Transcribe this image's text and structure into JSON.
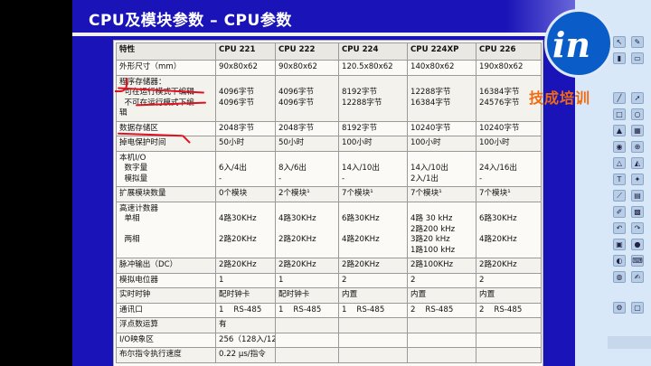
{
  "slide": {
    "title": "CPU及模块参数 – CPU参数"
  },
  "table": {
    "header": [
      "特性",
      "CPU 221",
      "CPU 222",
      "CPU 224",
      "CPU 224XP",
      "CPU 226"
    ],
    "rows": [
      {
        "label": [
          "外形尺寸（mm）"
        ],
        "cells": [
          [
            "90x80x62"
          ],
          [
            "90x80x62"
          ],
          [
            "120.5x80x62"
          ],
          [
            "140x80x62"
          ],
          [
            "190x80x62"
          ]
        ]
      },
      {
        "label": [
          "程序存储器：",
          "  可在运行模式下编辑",
          "  不可在运行模式下编",
          "辑"
        ],
        "cells": [
          [
            "",
            "4096字节",
            "4096字节"
          ],
          [
            "",
            "4096字节",
            "4096字节"
          ],
          [
            "",
            "8192字节",
            "12288字节"
          ],
          [
            "",
            "12288字节",
            "16384字节"
          ],
          [
            "",
            "16384字节",
            "24576字节"
          ]
        ]
      },
      {
        "label": [
          "数据存储区"
        ],
        "cells": [
          [
            "2048字节"
          ],
          [
            "2048字节"
          ],
          [
            "8192字节"
          ],
          [
            "10240字节"
          ],
          [
            "10240字节"
          ]
        ]
      },
      {
        "label": [
          "掉电保护时间"
        ],
        "cells": [
          [
            "50小时"
          ],
          [
            "50小时"
          ],
          [
            "100小时"
          ],
          [
            "100小时"
          ],
          [
            "100小时"
          ]
        ]
      },
      {
        "label": [
          "本机I/O",
          "  数字量",
          "  模拟量"
        ],
        "cells": [
          [
            "",
            "6入/4出",
            "-"
          ],
          [
            "",
            "8入/6出",
            "-"
          ],
          [
            "",
            "14入/10出",
            "-"
          ],
          [
            "",
            "14入/10出",
            "2入/1出"
          ],
          [
            "",
            "24入/16出",
            "-"
          ]
        ]
      },
      {
        "label": [
          "扩展模块数量"
        ],
        "cells": [
          [
            "0个模块"
          ],
          [
            "2个模块¹"
          ],
          [
            "7个模块¹"
          ],
          [
            "7个模块¹"
          ],
          [
            "7个模块¹"
          ]
        ]
      },
      {
        "label": [
          "高速计数器",
          "  单相",
          "",
          "  两相"
        ],
        "cells": [
          [
            "",
            "4路30KHz",
            "",
            "2路20KHz"
          ],
          [
            "",
            "4路30KHz",
            "",
            "2路20KHz"
          ],
          [
            "",
            "6路30KHz",
            "",
            "4路20KHz"
          ],
          [
            "",
            "4路 30 kHz",
            "2路200 kHz",
            "3路20 kHz",
            "1路100 kHz"
          ],
          [
            "",
            "6路30KHz",
            "",
            "4路20KHz"
          ]
        ]
      },
      {
        "label": [
          "脉冲输出（DC）"
        ],
        "cells": [
          [
            "2路20KHz"
          ],
          [
            "2路20KHz"
          ],
          [
            "2路20KHz"
          ],
          [
            "2路100KHz"
          ],
          [
            "2路20KHz"
          ]
        ]
      },
      {
        "label": [
          "模拟电位器"
        ],
        "cells": [
          [
            "1"
          ],
          [
            "1"
          ],
          [
            "2"
          ],
          [
            "2"
          ],
          [
            "2"
          ]
        ]
      },
      {
        "label": [
          "实时时钟"
        ],
        "cells": [
          [
            "配时钟卡"
          ],
          [
            "配时钟卡"
          ],
          [
            "内置"
          ],
          [
            "内置"
          ],
          [
            "内置"
          ]
        ]
      },
      {
        "label": [
          "通讯口"
        ],
        "cells": [
          [
            "1    RS-485"
          ],
          [
            "1    RS-485"
          ],
          [
            "1    RS-485"
          ],
          [
            "2    RS-485"
          ],
          [
            "2    RS-485"
          ]
        ]
      },
      {
        "label": [
          "浮点数运算"
        ],
        "cells": [
          [
            "有"
          ],
          [
            ""
          ],
          [
            ""
          ],
          [
            ""
          ],
          [
            ""
          ]
        ]
      },
      {
        "label": [
          "I/O映象区"
        ],
        "cells": [
          [
            "256（128入/128出）"
          ],
          [
            ""
          ],
          [
            ""
          ],
          [
            ""
          ],
          [
            ""
          ]
        ]
      },
      {
        "label": [
          "布尔指令执行速度"
        ],
        "cells": [
          [
            "0.22 μs/指令"
          ],
          [
            ""
          ],
          [
            ""
          ],
          [
            ""
          ],
          [
            ""
          ]
        ]
      }
    ]
  },
  "brand": {
    "logo_text": "in",
    "name": "技成培训"
  },
  "colors": {
    "slide_bg": "#1a14b8",
    "annotation": "#e01020",
    "brand_orange": "#f06a10",
    "logo_blue": "#0a5cc8"
  }
}
